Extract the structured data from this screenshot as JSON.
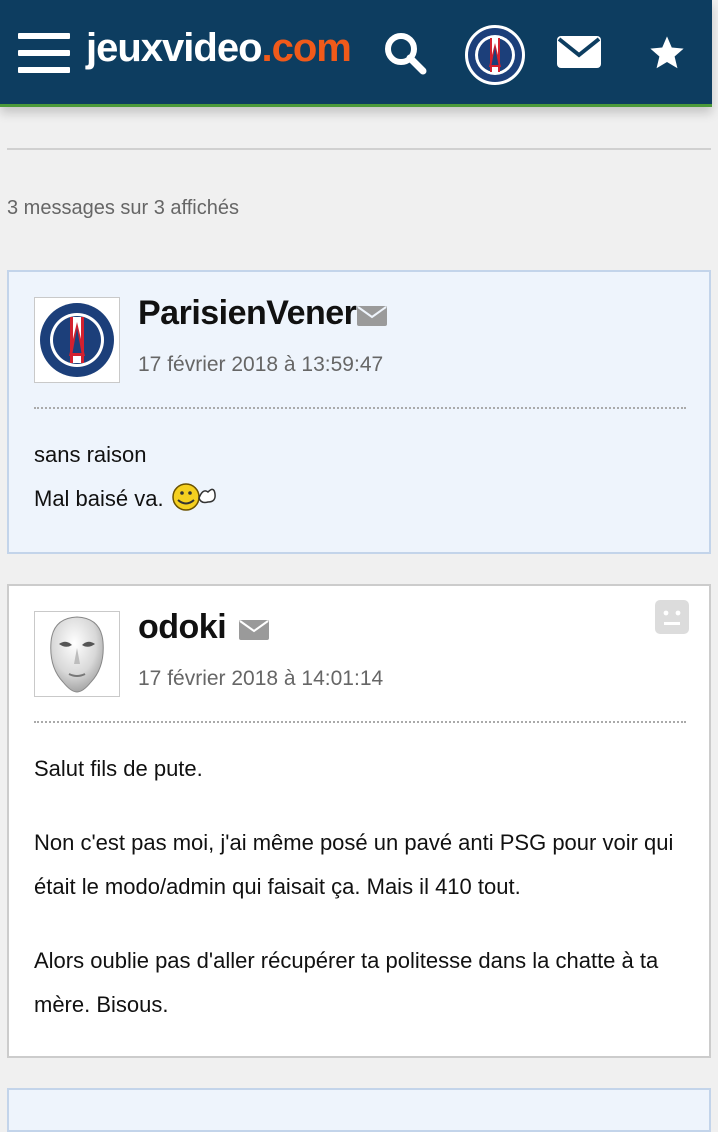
{
  "header": {
    "logo_main": "jeuxvideo",
    "logo_tld": ".com"
  },
  "count_text": "3 messages sur 3 affichés",
  "posts": [
    {
      "author": "ParisienVener",
      "date": "17 février 2018 à 13:59:47",
      "lines": [
        "sans raison",
        "Mal baisé va."
      ]
    },
    {
      "author": "odoki",
      "date": "17 février 2018 à 14:01:14",
      "paragraphs": [
        "Salut fils de pute.",
        "Non c'est pas moi, j'ai même posé un pavé anti PSG pour voir qui était le modo/admin qui faisait ça. Mais il 410 tout.",
        "Alors oublie pas d'aller récupérer ta politesse dans la chatte à ta mère. Bisous."
      ]
    }
  ],
  "icons": {
    "menu": "hamburger-icon",
    "search": "search-icon",
    "mail": "envelope-icon",
    "star": "star-icon",
    "report": "sad-face-icon"
  },
  "colors": {
    "header_bg": "#0d3d60",
    "logo_accent": "#f05a1a",
    "header_underline": "#4c9a3a",
    "post_blue_bg": "#eef4fc"
  }
}
